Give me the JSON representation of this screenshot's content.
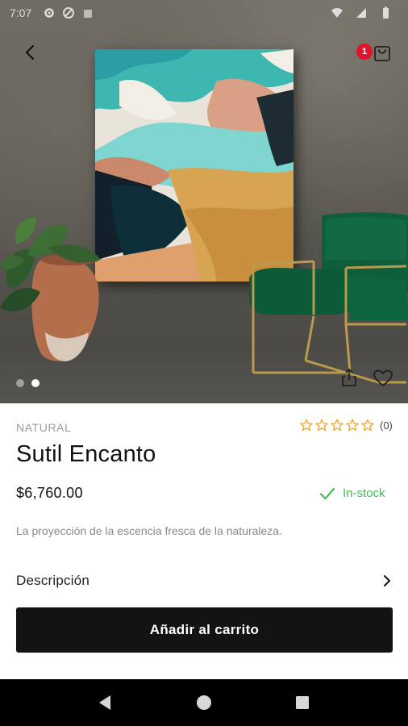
{
  "status_bar": {
    "time": "7:07",
    "icons": [
      "gear-icon",
      "vpn-icon",
      "wifi-icon",
      "signal-icon",
      "battery-icon"
    ]
  },
  "header": {
    "cart_count": "1",
    "icons": [
      "back-arrow-icon",
      "shopping-bag-icon"
    ]
  },
  "gallery": {
    "image_count": 2,
    "active_index": 1,
    "icons": [
      "share-icon",
      "heart-icon"
    ]
  },
  "product": {
    "brand": "NATURAL",
    "name": "Sutil Encanto",
    "price": "$6,760.00",
    "stock_status": "In-stock",
    "short_description": "La proyección de la escencia fresca de la naturaleza.",
    "rating_stars": 0,
    "rating_max": 5,
    "review_count": "(0)"
  },
  "details": {
    "description_label": "Descripción"
  },
  "actions": {
    "add_to_cart_label": "Añadir al carrito"
  },
  "nav_bar": {
    "icons": [
      "nav-back-icon",
      "nav-home-icon",
      "nav-recents-icon"
    ]
  },
  "colors": {
    "accent_stock": "#3cbf55",
    "badge": "#e0142b",
    "button_bg": "#131313",
    "star": "#f2a524"
  }
}
